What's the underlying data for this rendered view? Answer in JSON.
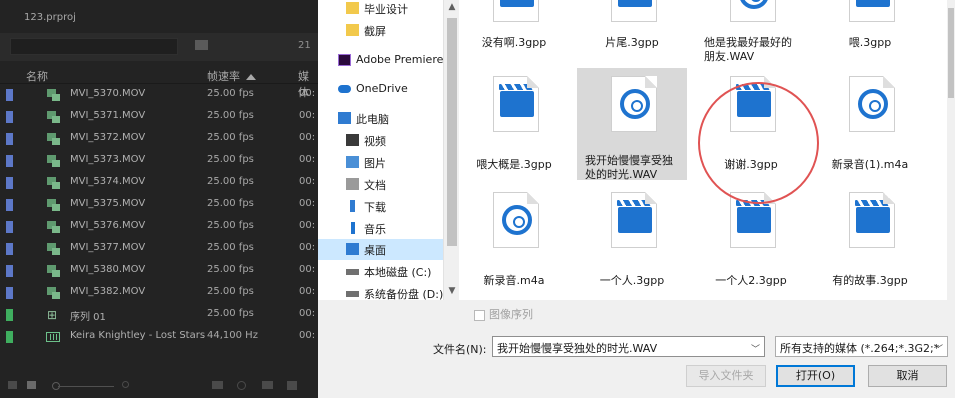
{
  "premiere": {
    "project_title": "123.prproj",
    "item_count": "21",
    "columns": {
      "name": "名称",
      "frame_rate": "帧速率",
      "media": "媒体"
    },
    "rows": [
      {
        "name": "MVI_5370.MOV",
        "rate": "25.00 fps",
        "extra": "00:",
        "kind": "clip",
        "chip": "#5d78c8"
      },
      {
        "name": "MVI_5371.MOV",
        "rate": "25.00 fps",
        "extra": "00:",
        "kind": "clip",
        "chip": "#5d78c8"
      },
      {
        "name": "MVI_5372.MOV",
        "rate": "25.00 fps",
        "extra": "00:",
        "kind": "clip",
        "chip": "#5d78c8"
      },
      {
        "name": "MVI_5373.MOV",
        "rate": "25.00 fps",
        "extra": "00:",
        "kind": "clip",
        "chip": "#5d78c8"
      },
      {
        "name": "MVI_5374.MOV",
        "rate": "25.00 fps",
        "extra": "00:",
        "kind": "clip",
        "chip": "#5d78c8"
      },
      {
        "name": "MVI_5375.MOV",
        "rate": "25.00 fps",
        "extra": "00:",
        "kind": "clip",
        "chip": "#5d78c8"
      },
      {
        "name": "MVI_5376.MOV",
        "rate": "25.00 fps",
        "extra": "00:",
        "kind": "clip",
        "chip": "#5d78c8"
      },
      {
        "name": "MVI_5377.MOV",
        "rate": "25.00 fps",
        "extra": "00:",
        "kind": "clip",
        "chip": "#5d78c8"
      },
      {
        "name": "MVI_5380.MOV",
        "rate": "25.00 fps",
        "extra": "00:",
        "kind": "clip",
        "chip": "#5d78c8"
      },
      {
        "name": "MVI_5382.MOV",
        "rate": "25.00 fps",
        "extra": "00:",
        "kind": "clip",
        "chip": "#5d78c8"
      },
      {
        "name": "序列 01",
        "rate": "25.00 fps",
        "extra": "00:",
        "kind": "sequence",
        "chip": "#3fae5f"
      },
      {
        "name": "Keira Knightley - Lost Stars",
        "rate": "44,100 Hz",
        "extra": "00:",
        "kind": "audio",
        "chip": "#3fae5f"
      }
    ]
  },
  "dialog": {
    "nav": [
      {
        "label": "毕业设计",
        "icon": "folder-icon",
        "color": "#f2c94c"
      },
      {
        "label": "截屏",
        "icon": "folder-icon",
        "color": "#f2c94c"
      },
      {
        "label": "Adobe Premiere",
        "icon": "premiere-icon",
        "color": "#2b0a3d"
      },
      {
        "label": "OneDrive",
        "icon": "cloud-icon",
        "color": "#1e73cf"
      },
      {
        "label": "此电脑",
        "icon": "computer-icon",
        "color": "#2f7bd1"
      },
      {
        "label": "视频",
        "icon": "video-icon",
        "color": "#3a3a3a"
      },
      {
        "label": "图片",
        "icon": "pictures-icon",
        "color": "#4a8fd6"
      },
      {
        "label": "文档",
        "icon": "documents-icon",
        "color": "#9a9a9a"
      },
      {
        "label": "下载",
        "icon": "download-icon",
        "color": "#2f7bd1"
      },
      {
        "label": "音乐",
        "icon": "music-icon",
        "color": "#1e73cf"
      },
      {
        "label": "桌面",
        "icon": "desktop-icon",
        "color": "#2f7bd1"
      },
      {
        "label": "本地磁盘 (C:)",
        "icon": "drive-icon",
        "color": "#707070"
      },
      {
        "label": "系统备份盘 (D:)",
        "icon": "drive-icon",
        "color": "#707070"
      }
    ],
    "selected_nav": "桌面",
    "files": [
      {
        "name": "没有啊.3gpp",
        "type": "video",
        "partial": true
      },
      {
        "name": "片尾.3gpp",
        "type": "video",
        "partial": true
      },
      {
        "name": "他是我最好最好的朋友.WAV",
        "type": "audio",
        "partial": true
      },
      {
        "name": "喂.3gpp",
        "type": "video",
        "partial": true
      },
      {
        "name": "喂大概是.3gpp",
        "type": "video"
      },
      {
        "name": "我开始慢慢享受独处的时光.WAV",
        "type": "audio",
        "selected": true
      },
      {
        "name": "谢谢.3gpp",
        "type": "video"
      },
      {
        "name": "新录音(1).m4a",
        "type": "audio"
      },
      {
        "name": "新录音.m4a",
        "type": "audio"
      },
      {
        "name": "一个人.3gpp",
        "type": "video"
      },
      {
        "name": "一个人2.3gpp",
        "type": "video"
      },
      {
        "name": "有的故事.3gpp",
        "type": "video"
      }
    ],
    "image_sequence_label": "图像序列",
    "filename_label": "文件名(N):",
    "filename_value": "我开始慢慢享受独处的时光.WAV",
    "filter_value": "所有支持的媒体 (*.264;*.3G2;*",
    "buttons": {
      "import_folder": "导入文件夹",
      "open": "打开(O)",
      "cancel": "取消"
    },
    "accent_color": "#1e73cf",
    "highlight_color": "#e05353"
  }
}
